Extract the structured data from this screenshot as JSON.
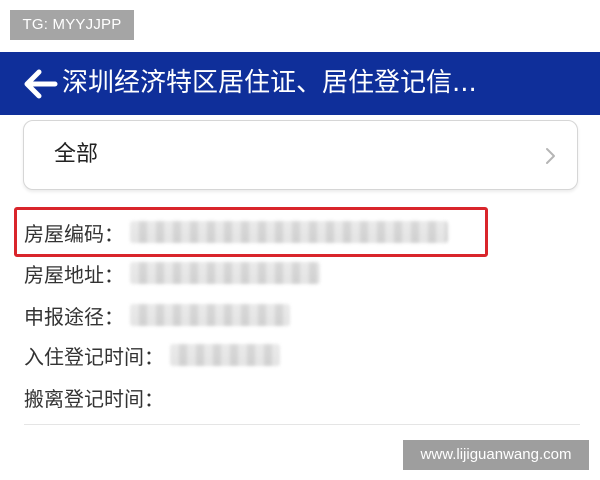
{
  "watermarks": {
    "top": "TG: MYYJJPP",
    "bottom": "www.lijiguanwang.com"
  },
  "header": {
    "back_icon": "back-arrow-icon",
    "title": "深圳经济特区居住证、居住登记信..."
  },
  "filter": {
    "label": "全部",
    "chevron_icon": "chevron-right-icon"
  },
  "fields": [
    {
      "label": "房屋编码："
    },
    {
      "label": "房屋地址："
    },
    {
      "label": "申报途径："
    },
    {
      "label": "入住登记时间："
    },
    {
      "label": "搬离登记时间："
    }
  ],
  "colors": {
    "header_bg": "#0f2f9a",
    "highlight": "#d9252b"
  }
}
